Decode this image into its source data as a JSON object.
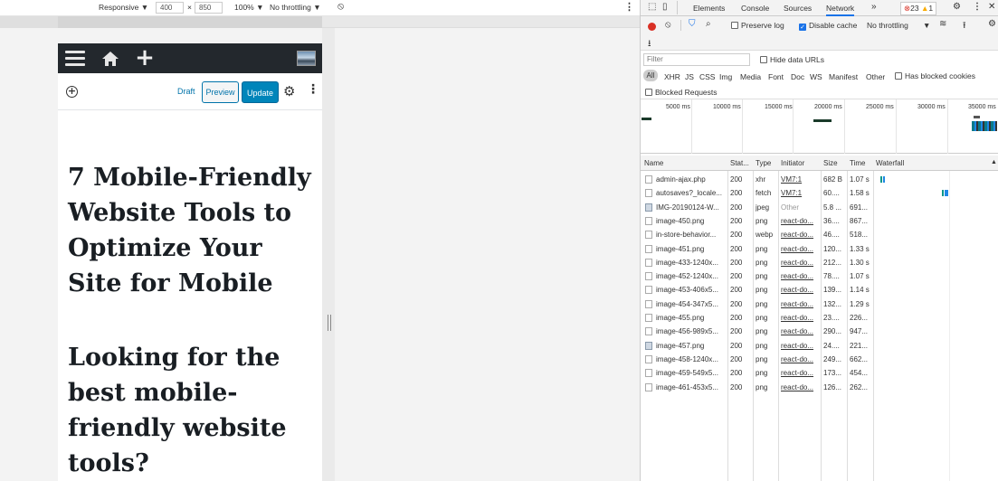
{
  "device_toolbar": {
    "device": "Responsive ▼",
    "width": "400",
    "times": "×",
    "height": "850",
    "zoom": "100% ▼",
    "throttle": "No throttling ▼",
    "rotate_icon": "rotate-icon"
  },
  "editor": {
    "draft_label": "Draft",
    "preview_label": "Preview",
    "update_label": "Update",
    "post_title": "7 Mobile-Friendly Website Tools to Optimize Your Site for Mobile",
    "post_heading": "Looking for the best mobile-friendly website tools?"
  },
  "devtools": {
    "tabs": [
      "Elements",
      "Console",
      "Sources",
      "Network"
    ],
    "more": "»",
    "errors": "23",
    "warnings": "1",
    "preserve_log": "Preserve log",
    "disable_cache": "Disable cache",
    "throttling": "No throttling",
    "filter_placeholder": "Filter",
    "hide_data_urls": "Hide data URLs",
    "types": [
      "All",
      "XHR",
      "JS",
      "CSS",
      "Img",
      "Media",
      "Font",
      "Doc",
      "WS",
      "Manifest",
      "Other"
    ],
    "has_blocked_cookies": "Has blocked cookies",
    "blocked_requests": "Blocked Requests",
    "ticks": [
      "5000 ms",
      "10000 ms",
      "15000 ms",
      "20000 ms",
      "25000 ms",
      "30000 ms",
      "35000 ms"
    ],
    "columns": [
      "Name",
      "Stat...",
      "Type",
      "Initiator",
      "Size",
      "Time",
      "Waterfall"
    ],
    "rows": [
      {
        "name": "admin-ajax.php",
        "status": "200",
        "type": "xhr",
        "initiator": "VM7:1",
        "size": "682 B",
        "time": "1.07 s"
      },
      {
        "name": "autosaves?_locale...",
        "status": "200",
        "type": "fetch",
        "initiator": "VM7:1",
        "size": "60....",
        "time": "1.58 s"
      },
      {
        "name": "IMG-20190124-W...",
        "status": "200",
        "type": "jpeg",
        "initiator": "Other",
        "size": "5.8 ...",
        "time": "691..."
      },
      {
        "name": "image-450.png",
        "status": "200",
        "type": "png",
        "initiator": "react-do...",
        "size": "36....",
        "time": "867..."
      },
      {
        "name": "in-store-behavior...",
        "status": "200",
        "type": "webp",
        "initiator": "react-do...",
        "size": "46....",
        "time": "518..."
      },
      {
        "name": "image-451.png",
        "status": "200",
        "type": "png",
        "initiator": "react-do...",
        "size": "120...",
        "time": "1.33 s"
      },
      {
        "name": "image-433-1240x...",
        "status": "200",
        "type": "png",
        "initiator": "react-do...",
        "size": "212...",
        "time": "1.30 s"
      },
      {
        "name": "image-452-1240x...",
        "status": "200",
        "type": "png",
        "initiator": "react-do...",
        "size": "78....",
        "time": "1.07 s"
      },
      {
        "name": "image-453-406x5...",
        "status": "200",
        "type": "png",
        "initiator": "react-do...",
        "size": "139...",
        "time": "1.14 s"
      },
      {
        "name": "image-454-347x5...",
        "status": "200",
        "type": "png",
        "initiator": "react-do...",
        "size": "132...",
        "time": "1.29 s"
      },
      {
        "name": "image-455.png",
        "status": "200",
        "type": "png",
        "initiator": "react-do...",
        "size": "23....",
        "time": "226..."
      },
      {
        "name": "image-456-989x5...",
        "status": "200",
        "type": "png",
        "initiator": "react-do...",
        "size": "290...",
        "time": "947..."
      },
      {
        "name": "image-457.png",
        "status": "200",
        "type": "png",
        "initiator": "react-do...",
        "size": "24....",
        "time": "221..."
      },
      {
        "name": "image-458-1240x...",
        "status": "200",
        "type": "png",
        "initiator": "react-do...",
        "size": "249...",
        "time": "662..."
      },
      {
        "name": "image-459-549x5...",
        "status": "200",
        "type": "png",
        "initiator": "react-do...",
        "size": "173...",
        "time": "454..."
      },
      {
        "name": "image-461-453x5...",
        "status": "200",
        "type": "png",
        "initiator": "react-do...",
        "size": "126...",
        "time": "262..."
      }
    ]
  }
}
